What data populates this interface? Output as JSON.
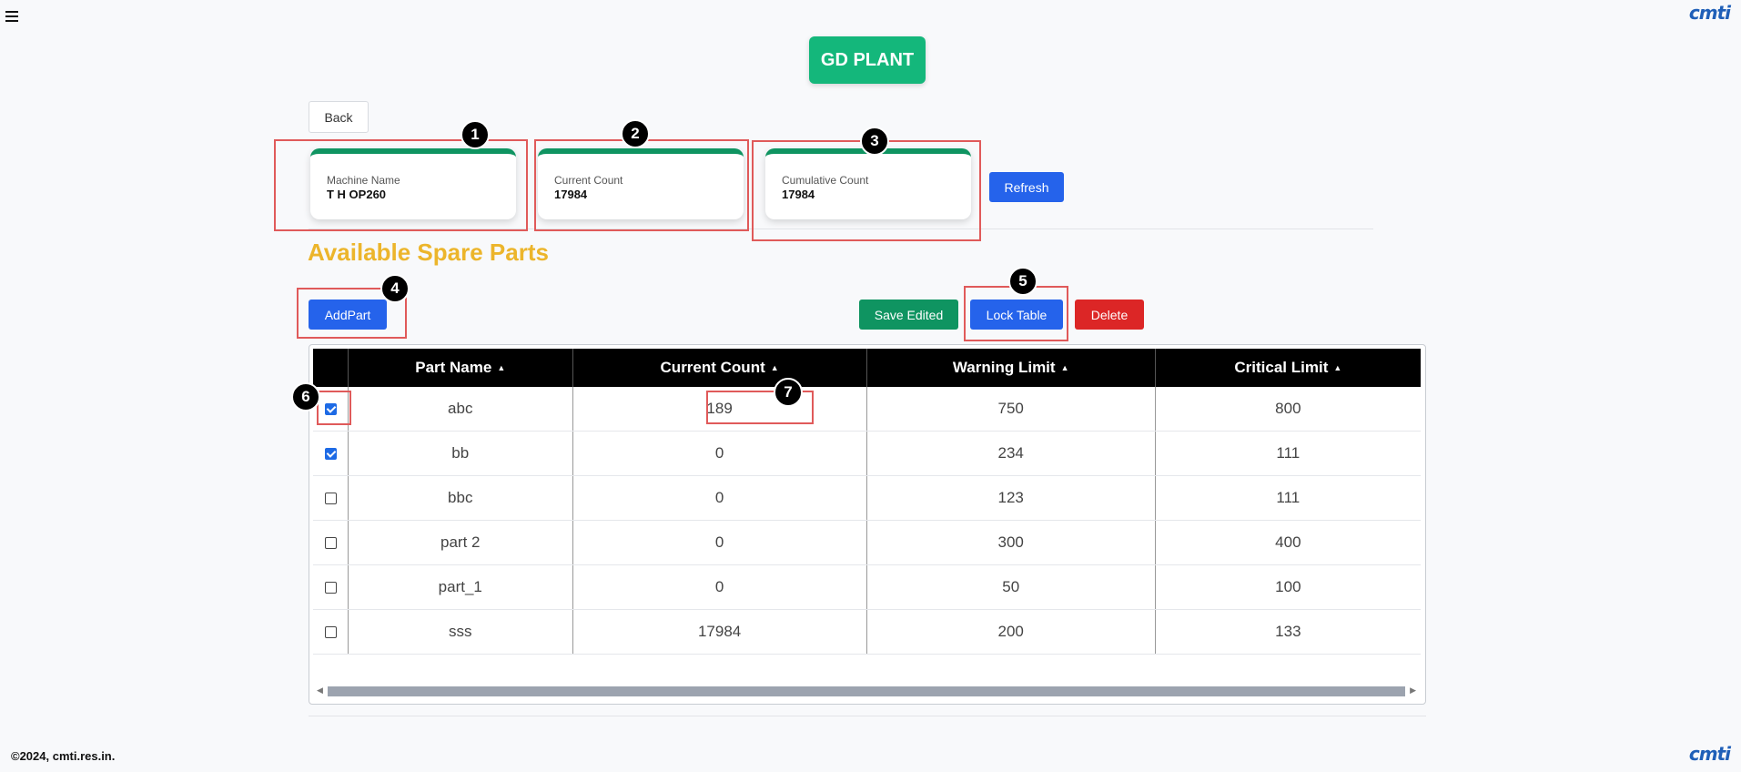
{
  "header": {
    "plant_title": "GD PLANT",
    "logo_text": "cmti"
  },
  "back_label": "Back",
  "cards": [
    {
      "label": "Machine Name",
      "value": "T H OP260"
    },
    {
      "label": "Current Count",
      "value": "17984"
    },
    {
      "label": "Cumulative Count",
      "value": "17984"
    }
  ],
  "refresh_label": "Refresh",
  "section_title": "Available Spare Parts",
  "toolbar": {
    "add_part": "AddPart",
    "save_edited": "Save Edited",
    "lock_table": "Lock Table",
    "delete": "Delete"
  },
  "annotations": [
    "1",
    "2",
    "3",
    "4",
    "5",
    "6",
    "7"
  ],
  "table": {
    "columns": [
      "Part Name",
      "Current Count",
      "Warning Limit",
      "Critical Limit"
    ],
    "rows": [
      {
        "checked": true,
        "part_name": "abc",
        "current_count": "189",
        "warning_limit": "750",
        "critical_limit": "800"
      },
      {
        "checked": true,
        "part_name": "bb",
        "current_count": "0",
        "warning_limit": "234",
        "critical_limit": "111"
      },
      {
        "checked": false,
        "part_name": "bbc",
        "current_count": "0",
        "warning_limit": "123",
        "critical_limit": "111"
      },
      {
        "checked": false,
        "part_name": "part 2",
        "current_count": "0",
        "warning_limit": "300",
        "critical_limit": "400"
      },
      {
        "checked": false,
        "part_name": "part_1",
        "current_count": "0",
        "warning_limit": "50",
        "critical_limit": "100"
      },
      {
        "checked": false,
        "part_name": "sss",
        "current_count": "17984",
        "warning_limit": "200",
        "critical_limit": "133"
      }
    ]
  },
  "footer": "©2024, cmti.res.in.",
  "colors": {
    "accent_green": "#14b77b",
    "card_top": "#0f9461",
    "primary_blue": "#2563eb",
    "danger_red": "#dc2626",
    "title_yellow": "#ecb52b",
    "annotation_red": "#e05a5a"
  }
}
